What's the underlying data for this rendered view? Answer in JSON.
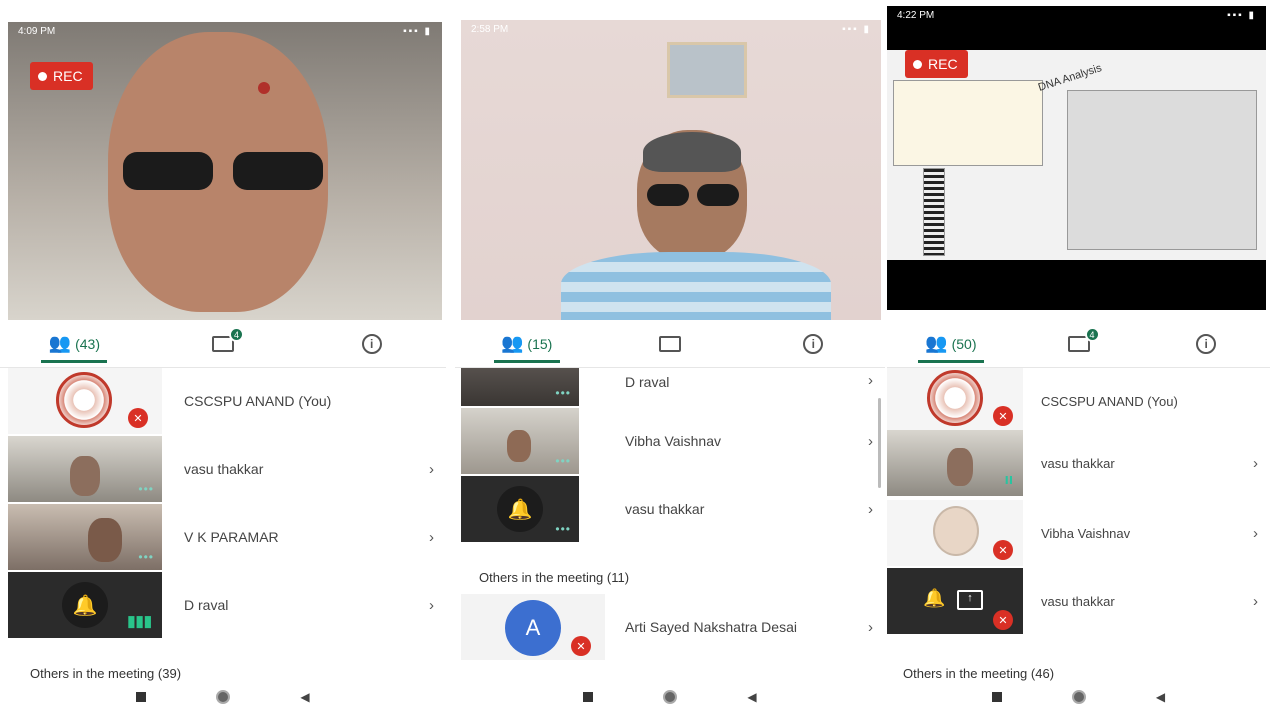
{
  "panels": [
    {
      "status_time": "4:09 PM",
      "rec_label": "REC",
      "tabs": {
        "people_count": "(43)",
        "chat_badge": "4",
        "chat_label": "",
        "info_label": "i"
      },
      "participants": [
        {
          "name": "CSCSPU ANAND (You)"
        },
        {
          "name": "vasu thakkar"
        },
        {
          "name": "V K PARAMAR"
        },
        {
          "name": "D raval"
        }
      ],
      "others_label": "Others in the meeting (39)"
    },
    {
      "status_time": "2:58 PM",
      "rec_label": "",
      "tabs": {
        "people_count": "(15)",
        "chat_badge": "",
        "info_label": "i"
      },
      "participants": [
        {
          "name": "D raval"
        },
        {
          "name": "Vibha Vaishnav"
        },
        {
          "name": "vasu thakkar"
        }
      ],
      "others_label": "Others in the meeting (11)",
      "others": [
        {
          "initial": "A",
          "name": "Arti Sayed Nakshatra Desai"
        }
      ]
    },
    {
      "status_time": "4:22 PM",
      "rec_label": "REC",
      "slide_label": "DNA Analysis",
      "tabs": {
        "people_count": "(50)",
        "chat_badge": "4",
        "info_label": "i"
      },
      "participants": [
        {
          "name": "CSCSPU ANAND (You)"
        },
        {
          "name": "vasu thakkar"
        },
        {
          "name": "Vibha Vaishnav"
        },
        {
          "name": "vasu thakkar"
        }
      ],
      "others_label": "Others in the meeting (46)"
    }
  ],
  "icons": {
    "chevron": "›",
    "people": "people-icon",
    "chat": "chat-icon",
    "info": "info-icon",
    "mic_off": "mic-off-icon",
    "speaker": "bell-speaker-icon"
  },
  "colors": {
    "accent": "#1a7350",
    "rec": "#d93025",
    "avatar_blue": "#3c6fd0"
  }
}
